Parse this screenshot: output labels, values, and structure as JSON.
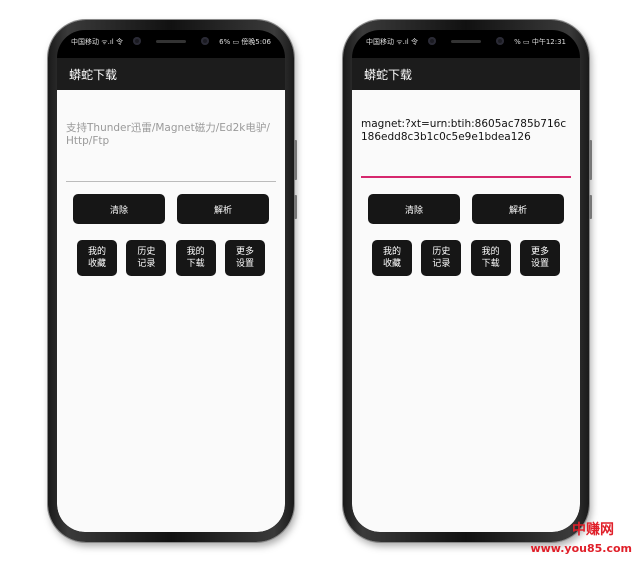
{
  "left": {
    "status_left": "中国移动 ᯤ.ıl 令",
    "status_right": "36% ▭ 傍晚5:06",
    "app_title": "蟒蛇下载",
    "input_placeholder": "支持Thunder迅雷/Magnet磁力/Ed2k电驴/Http/Ftp",
    "btn_clear": "清除",
    "btn_parse": "解析",
    "btn_fav": "我的收藏",
    "btn_history": "历史记录",
    "btn_downloads": "我的下载",
    "btn_settings": "更多设置"
  },
  "right": {
    "status_left": "中国移动 ᯤ.ıl 令",
    "status_right": "8% ▭ 中午12:31",
    "app_title": "蟒蛇下载",
    "input_value": "magnet:?xt=urn:btih:8605ac785b716c186edd8c3b1c0c5e9e1bdea126",
    "btn_clear": "清除",
    "btn_parse": "解析",
    "btn_fav": "我的收藏",
    "btn_history": "历史记录",
    "btn_downloads": "我的下载",
    "btn_settings": "更多设置"
  },
  "watermark": {
    "text1": "中赚网",
    "text2": "www.you85.com"
  },
  "colors": {
    "accent_underline": "#d6286e",
    "watermark": "#e0202a",
    "button_bg": "#161616"
  }
}
